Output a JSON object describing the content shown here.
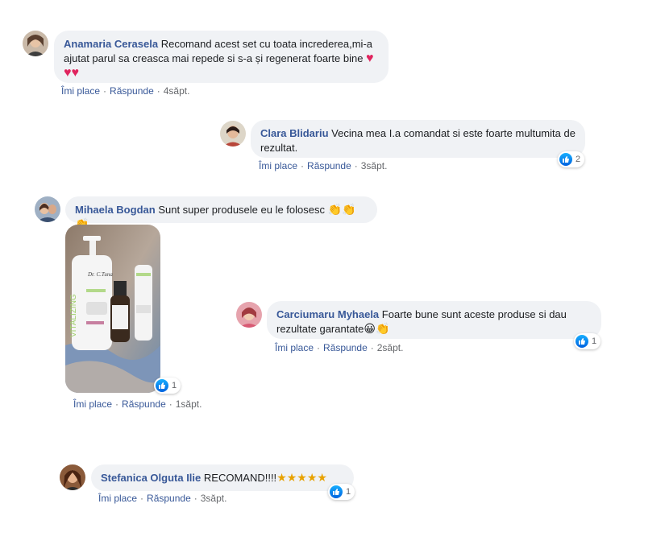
{
  "comments": [
    {
      "author": "Anamaria Cerasela",
      "text_line1": "Recomand acest set cu toata increderea,mi-a",
      "text_line2": "ajutat parul sa creasca mai repede si s-a și regenerat foarte bine",
      "like": "Îmi place",
      "reply": "Răspunde",
      "time": "4săpt.",
      "icon": "heart-emoji"
    },
    {
      "author": "Clara Blidariu",
      "text_line1": "Vecina mea I.a comandat si este foarte multumita de",
      "text_line2": "rezultat.",
      "like": "Îmi place",
      "reply": "Răspunde",
      "time": "3săpt.",
      "reactions": "2"
    },
    {
      "author": "Mihaela Bogdan",
      "text": "Sunt super produsele eu le folosesc",
      "like": "Îmi place",
      "reply": "Răspunde",
      "time": "1săpt.",
      "reactions": "1",
      "icon": "clapping-hands-emoji"
    },
    {
      "author": "Carciumaru Myhaela",
      "text_line1": "Foarte bune sunt aceste produse si dau",
      "text_line2": "rezultate garantate",
      "like": "Îmi place",
      "reply": "Răspunde",
      "time": "2săpt.",
      "reactions": "1"
    },
    {
      "author": "Stefanica Olguta Ilie",
      "text": "RECOMAND!!!!",
      "like": "Îmi place",
      "reply": "Răspunde",
      "time": "3săpt.",
      "reactions": "1",
      "icon": "star-struck-emoji"
    }
  ],
  "photo": {
    "brand": "Dr. C.Tuna",
    "product_text": "VITALIZING"
  },
  "colors": {
    "bubble": "#f0f2f5",
    "author": "#385898",
    "meta": "#65676b",
    "like_blue": "#1877f2"
  }
}
